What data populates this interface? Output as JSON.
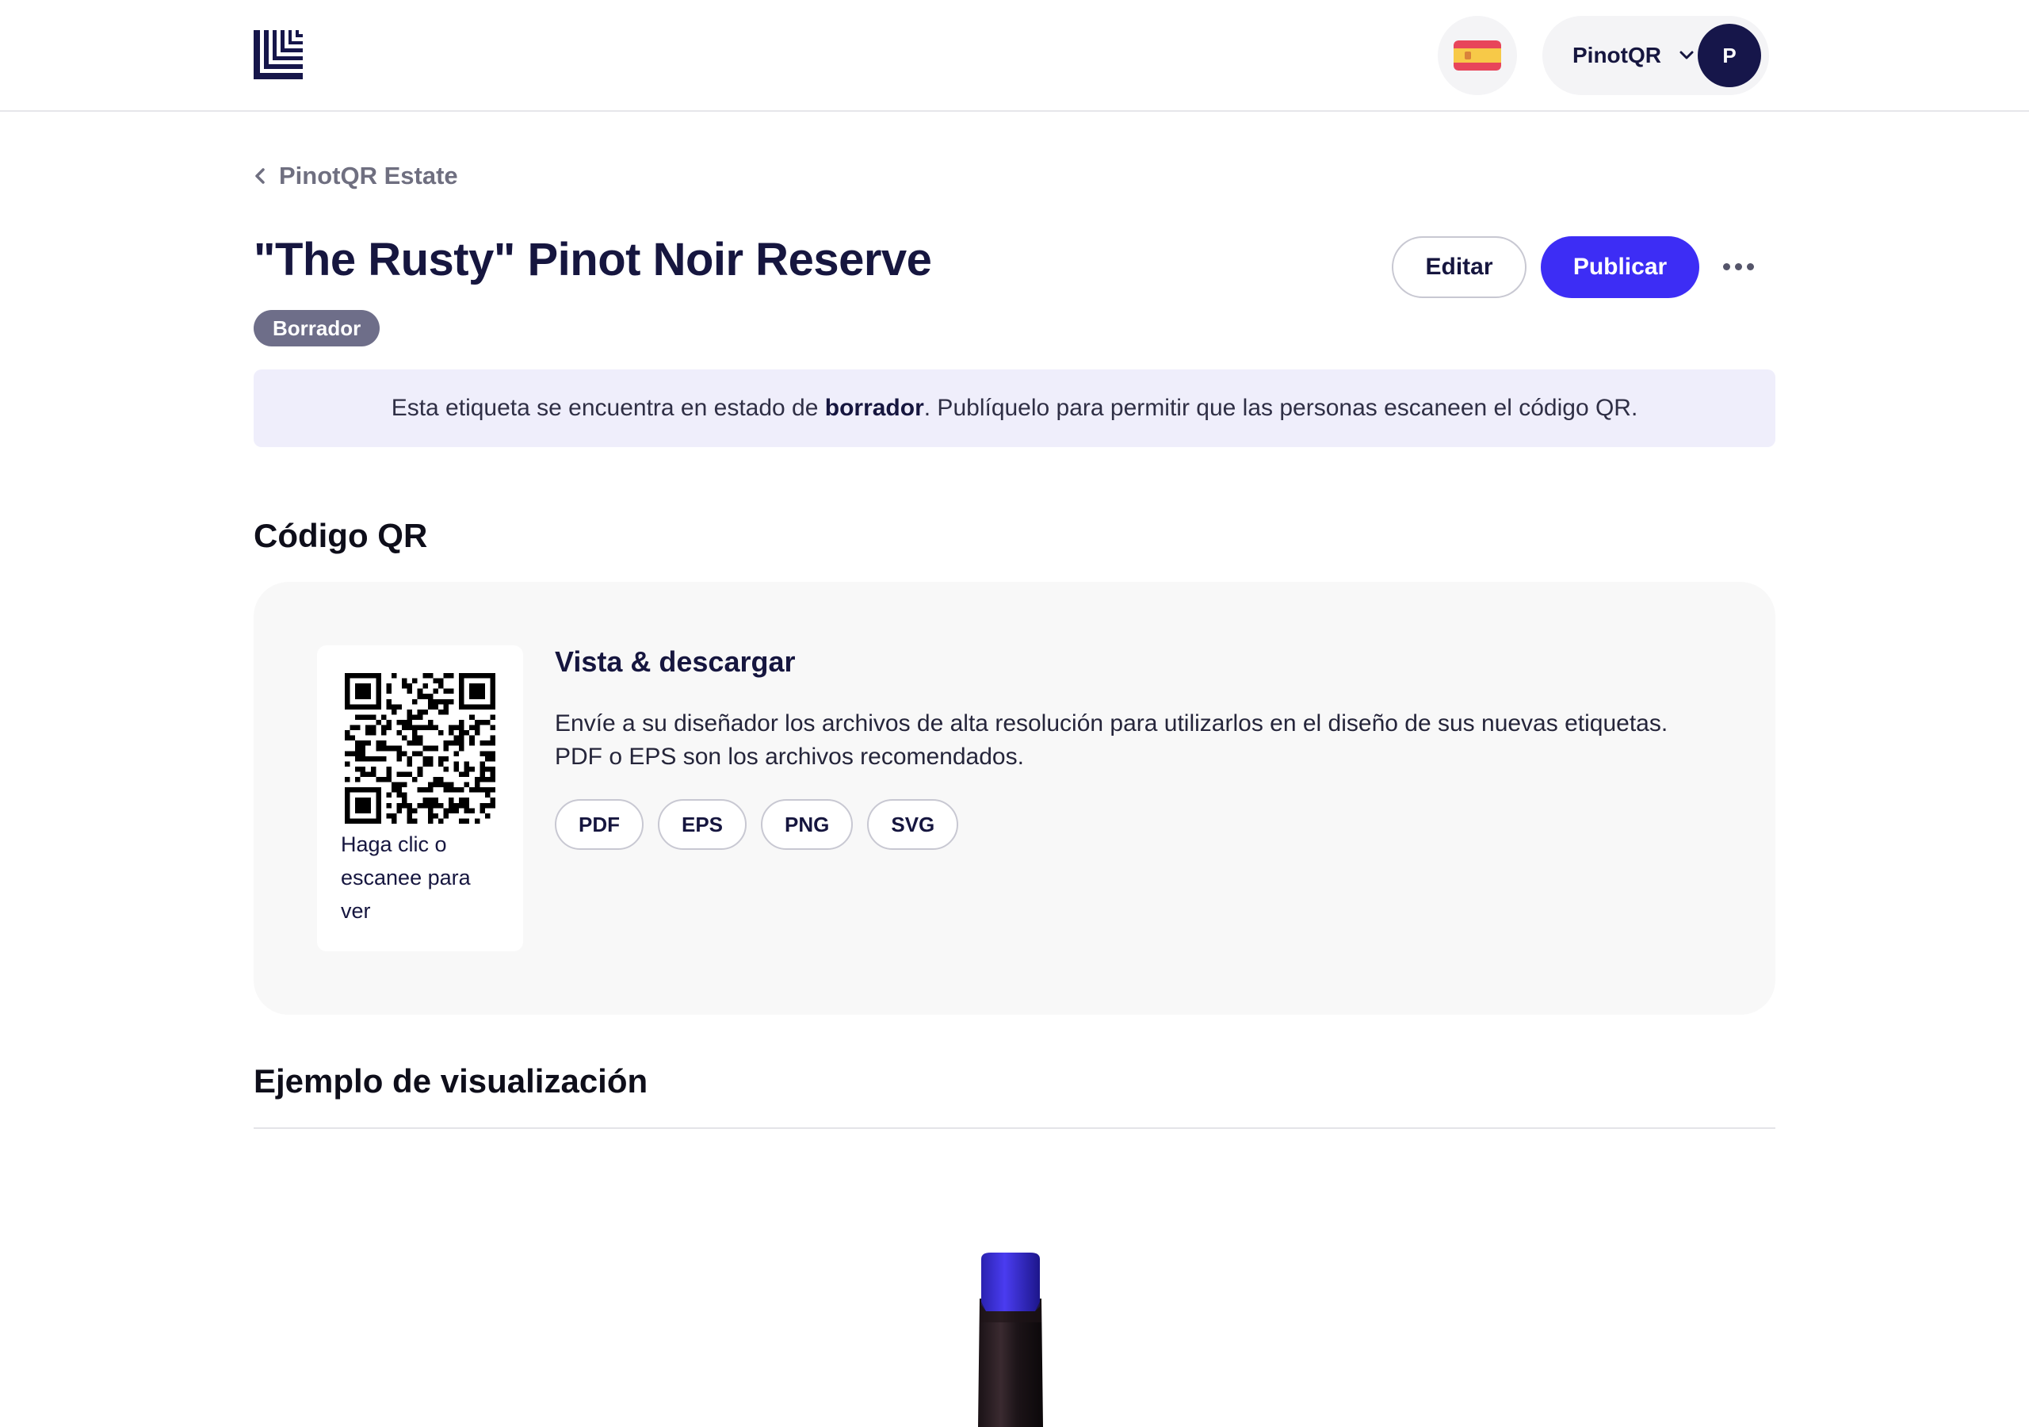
{
  "header": {
    "account_name": "PinotQR",
    "avatar_initial": "P"
  },
  "breadcrumb": {
    "label": "PinotQR Estate"
  },
  "page": {
    "title": "\"The Rusty\" Pinot Noir Reserve",
    "status": "Borrador"
  },
  "actions": {
    "edit_label": "Editar",
    "publish_label": "Publicar"
  },
  "notice": {
    "before": "Esta etiqueta se encuentra en estado de ",
    "bold": "borrador",
    "after": ". Publíquelo para permitir que las personas escaneen el código QR."
  },
  "qr_section": {
    "title": "Código QR",
    "caption": "Haga clic o escanee para ver",
    "download_title": "Vista & descargar",
    "description": "Envíe a su diseñador los archivos de alta resolución para utilizarlos en el diseño de sus nuevas etiquetas. PDF o EPS son los archivos recomendados.",
    "formats": [
      "PDF",
      "EPS",
      "PNG",
      "SVG"
    ]
  },
  "preview_section": {
    "title": "Ejemplo de visualización"
  },
  "colors": {
    "primary": "#3d2df5",
    "navy": "#16164a",
    "badge": "#6e6e89",
    "notice_bg": "#efeefb"
  }
}
